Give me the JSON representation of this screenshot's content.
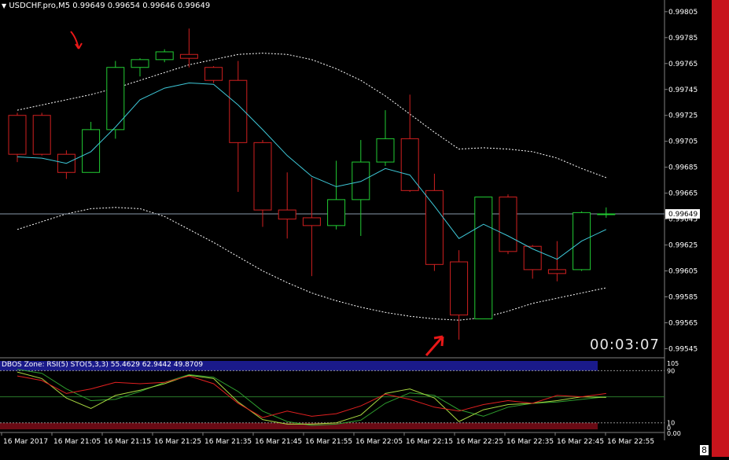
{
  "header": {
    "symbol_line": "USDCHF.pro,M5  0.99649 0.99654 0.99646 0.99649"
  },
  "timer": {
    "text": "00:03:07"
  },
  "price_scale": {
    "ticks": [
      "0.99805",
      "0.99785",
      "0.99765",
      "0.99745",
      "0.99725",
      "0.99705",
      "0.99685",
      "0.99665",
      "0.99645",
      "0.99625",
      "0.99605",
      "0.99585",
      "0.99565",
      "0.99545"
    ],
    "current_price_label": "0.99649"
  },
  "indicator": {
    "label": "DBOS Zone: RSI(5)   STO(5,3,3)   55.4629 62.9442 49.8709",
    "scale_labels": [
      "105",
      "90",
      "10",
      "0",
      "0.00"
    ]
  },
  "time_axis": {
    "labels": [
      "16 Mar 2017",
      "16 Mar 21:05",
      "16 Mar 21:15",
      "16 Mar 21:25",
      "16 Mar 21:35",
      "16 Mar 21:45",
      "16 Mar 21:55",
      "16 Mar 22:05",
      "16 Mar 22:15",
      "16 Mar 22:25",
      "16 Mar 22:35",
      "16 Mar 22:45",
      "16 Mar 22:55"
    ]
  },
  "side_strip": {
    "digit": "8"
  },
  "colors": {
    "background": "#000000",
    "bull": "#22cc33",
    "bear": "#d02020",
    "ma": "#3ec8d8",
    "band": "#ffffff",
    "grid": "#808080",
    "rsi": "#e02020",
    "sto_main": "#a8d840",
    "sto_signal": "#2e9e2e",
    "zone_high": "#1a1a8a",
    "zone_low": "#6a0a14",
    "arrow": "#e81818"
  },
  "chart_data": {
    "type": "candlestick",
    "title": "USDCHF.pro,M5",
    "ylim": [
      0.99538,
      0.99814
    ],
    "candles": [
      {
        "o": 0.99725,
        "h": 0.99727,
        "l": 0.99689,
        "c": 0.99695
      },
      {
        "o": 0.99725,
        "h": 0.99727,
        "l": 0.99694,
        "c": 0.99695
      },
      {
        "o": 0.99695,
        "h": 0.99698,
        "l": 0.99676,
        "c": 0.99681
      },
      {
        "o": 0.99681,
        "h": 0.9972,
        "l": 0.99681,
        "c": 0.99714
      },
      {
        "o": 0.99714,
        "h": 0.99767,
        "l": 0.99707,
        "c": 0.99762
      },
      {
        "o": 0.99762,
        "h": 0.99769,
        "l": 0.99755,
        "c": 0.99768
      },
      {
        "o": 0.99768,
        "h": 0.99776,
        "l": 0.99766,
        "c": 0.99774
      },
      {
        "o": 0.99772,
        "h": 0.99792,
        "l": 0.99762,
        "c": 0.99769
      },
      {
        "o": 0.99762,
        "h": 0.99763,
        "l": 0.9975,
        "c": 0.99752
      },
      {
        "o": 0.99752,
        "h": 0.99767,
        "l": 0.99666,
        "c": 0.99704
      },
      {
        "o": 0.99704,
        "h": 0.99706,
        "l": 0.99639,
        "c": 0.99652
      },
      {
        "o": 0.99652,
        "h": 0.99681,
        "l": 0.9963,
        "c": 0.99645
      },
      {
        "o": 0.99646,
        "h": 0.99677,
        "l": 0.99601,
        "c": 0.9964
      },
      {
        "o": 0.9964,
        "h": 0.9969,
        "l": 0.99637,
        "c": 0.9966
      },
      {
        "o": 0.9966,
        "h": 0.99706,
        "l": 0.99632,
        "c": 0.99689
      },
      {
        "o": 0.99689,
        "h": 0.99729,
        "l": 0.99686,
        "c": 0.99707
      },
      {
        "o": 0.99707,
        "h": 0.99741,
        "l": 0.99666,
        "c": 0.99667
      },
      {
        "o": 0.99667,
        "h": 0.9968,
        "l": 0.99605,
        "c": 0.9961
      },
      {
        "o": 0.99612,
        "h": 0.99621,
        "l": 0.99552,
        "c": 0.99571
      },
      {
        "o": 0.99568,
        "h": 0.99662,
        "l": 0.99568,
        "c": 0.99662
      },
      {
        "o": 0.99662,
        "h": 0.99664,
        "l": 0.99618,
        "c": 0.9962
      },
      {
        "o": 0.99624,
        "h": 0.99625,
        "l": 0.99599,
        "c": 0.99606
      },
      {
        "o": 0.99606,
        "h": 0.99628,
        "l": 0.99597,
        "c": 0.99603
      },
      {
        "o": 0.99606,
        "h": 0.99651,
        "l": 0.99605,
        "c": 0.9965
      },
      {
        "o": 0.99649,
        "h": 0.99654,
        "l": 0.99646,
        "c": 0.99649
      }
    ],
    "ma": [
      0.99693,
      0.99692,
      0.99688,
      0.99697,
      0.99716,
      0.99737,
      0.99746,
      0.9975,
      0.99749,
      0.99733,
      0.99714,
      0.99694,
      0.99678,
      0.9967,
      0.99674,
      0.99684,
      0.99679,
      0.99655,
      0.9963,
      0.99641,
      0.99632,
      0.99622,
      0.99614,
      0.99628,
      0.99637
    ],
    "upper_band": [
      0.99729,
      0.99733,
      0.99737,
      0.99741,
      0.99746,
      0.99752,
      0.99758,
      0.99764,
      0.99768,
      0.99772,
      0.99773,
      0.99772,
      0.99768,
      0.99761,
      0.99752,
      0.9974,
      0.99726,
      0.99712,
      0.99699,
      0.997,
      0.99699,
      0.99697,
      0.99692,
      0.99684,
      0.99677
    ],
    "lower_band": [
      0.99637,
      0.99643,
      0.99649,
      0.99653,
      0.99654,
      0.99653,
      0.99647,
      0.99637,
      0.99627,
      0.99616,
      0.99605,
      0.99596,
      0.99588,
      0.99582,
      0.99577,
      0.99573,
      0.9957,
      0.99568,
      0.99567,
      0.99569,
      0.99574,
      0.9958,
      0.99584,
      0.99588,
      0.99592
    ],
    "current_price": 0.99649,
    "oscillator": {
      "ylim": [
        0,
        105
      ],
      "levels": [
        90,
        10
      ],
      "rsi": [
        82,
        75,
        55,
        62,
        72,
        70,
        72,
        82,
        70,
        40,
        18,
        28,
        20,
        24,
        36,
        54,
        46,
        34,
        28,
        38,
        44,
        40,
        52,
        50,
        55
      ],
      "sto_main": [
        88,
        78,
        48,
        32,
        52,
        60,
        70,
        83,
        78,
        42,
        15,
        8,
        8,
        10,
        22,
        55,
        62,
        48,
        12,
        30,
        38,
        40,
        44,
        50,
        49
      ],
      "sto_signal": [
        92,
        86,
        62,
        44,
        46,
        58,
        72,
        84,
        80,
        58,
        28,
        12,
        6,
        8,
        14,
        40,
        56,
        52,
        30,
        20,
        34,
        40,
        42,
        46,
        50
      ]
    }
  }
}
